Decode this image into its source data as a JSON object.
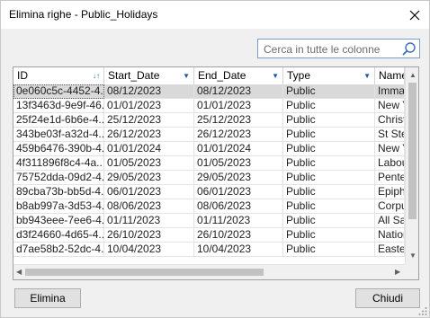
{
  "window": {
    "title": "Elimina righe - Public_Holidays"
  },
  "search": {
    "placeholder": "Cerca in tutte le colonne",
    "value": ""
  },
  "grid": {
    "columns": [
      {
        "label": "ID",
        "sort": "↓↑"
      },
      {
        "label": "Start_Date",
        "sort": "▼"
      },
      {
        "label": "End_Date",
        "sort": "▼"
      },
      {
        "label": "Type",
        "sort": "▼"
      },
      {
        "label": "Name",
        "sort": ""
      }
    ],
    "rows": [
      [
        "0e060c5c-4452-4...",
        "08/12/2023",
        "08/12/2023",
        "Public",
        "Immaco"
      ],
      [
        "13f3463d-9e9f-46...",
        "01/01/2023",
        "01/01/2023",
        "Public",
        "New Y"
      ],
      [
        "25f24e1d-6b6e-4...",
        "25/12/2023",
        "25/12/2023",
        "Public",
        "Christm"
      ],
      [
        "343be03f-a32d-4...",
        "26/12/2023",
        "26/12/2023",
        "Public",
        "St Step"
      ],
      [
        "459b6476-390b-4...",
        "01/01/2024",
        "01/01/2024",
        "Public",
        "New Y"
      ],
      [
        "4f311896f8c4-4a...",
        "01/05/2023",
        "01/05/2023",
        "Public",
        "Labour"
      ],
      [
        "75752dda-09d2-4...",
        "29/05/2023",
        "29/05/2023",
        "Public",
        "Pentec"
      ],
      [
        "89cba73b-bb5d-4...",
        "06/01/2023",
        "06/01/2023",
        "Public",
        "Epipha"
      ],
      [
        "b8ab997a-3d53-4...",
        "08/06/2023",
        "08/06/2023",
        "Public",
        "Corpus"
      ],
      [
        "bb943eee-7ee6-4...",
        "01/11/2023",
        "01/11/2023",
        "Public",
        "All Sain"
      ],
      [
        "d3f24660-4d65-4...",
        "26/10/2023",
        "26/10/2023",
        "Public",
        "Nationa"
      ],
      [
        "d7ae58b2-52dc-4...",
        "10/04/2023",
        "10/04/2023",
        "Public",
        "Easter"
      ]
    ],
    "selected_row": 0
  },
  "buttons": {
    "delete": "Elimina",
    "close": "Chiudi"
  }
}
